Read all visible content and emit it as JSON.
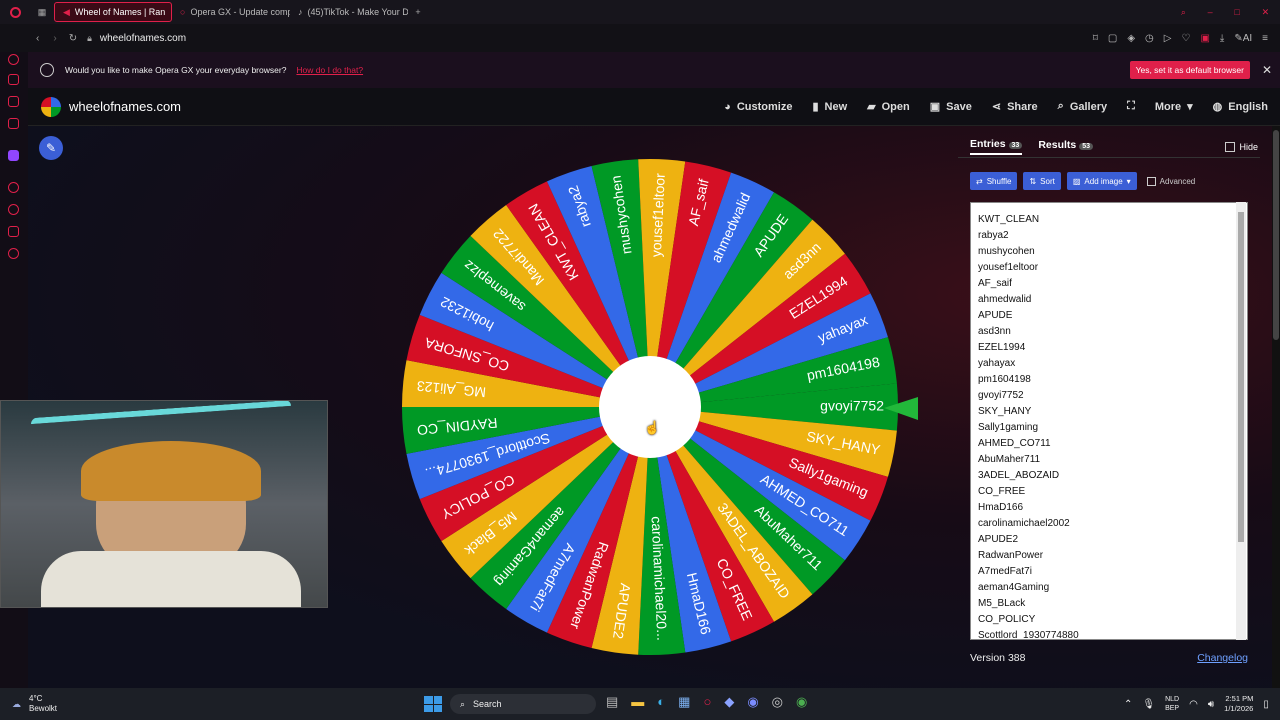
{
  "browser": {
    "tabs": [
      {
        "label": "Wheel of Names | Ran"
      },
      {
        "label": "Opera GX - Update comp"
      },
      {
        "label": "(45)TikTok - Make Your D"
      }
    ],
    "url": "wheelofnames.com",
    "ai_label": "AI"
  },
  "notification": {
    "message": "Would you like to make Opera GX your everyday browser?",
    "link": "How do I do that?",
    "action": "Yes, set it as default browser"
  },
  "site": {
    "logo": "wheelofnames.com",
    "nav": {
      "customize": "Customize",
      "new": "New",
      "open": "Open",
      "save": "Save",
      "share": "Share",
      "gallery": "Gallery",
      "more": "More",
      "language": "English"
    }
  },
  "panel": {
    "entries_tab": "Entries",
    "entries_count": "33",
    "results_tab": "Results",
    "results_count": "53",
    "hide": "Hide",
    "shuffle": "Shuffle",
    "sort": "Sort",
    "add_image": "Add image",
    "advanced": "Advanced",
    "version": "Version 388",
    "changelog": "Changelog"
  },
  "entries": [
    "KWT_CLEAN",
    "rabya2",
    "mushycohen",
    "yousef1eltoor",
    "AF_saif",
    "ahmedwalid",
    "APUDE",
    "asd3nn",
    "EZEL1994",
    "yahayax",
    "pm1604198",
    "gvoyi7752",
    "SKY_HANY",
    "Sally1gaming",
    "AHMED_CO711",
    "AbuMaher711",
    "3ADEL_ABOZAID",
    "CO_FREE",
    "HmaD166",
    "carolinamichael2002",
    "APUDE2",
    "RadwanPower",
    "A7medFat7i",
    "aeman4Gaming",
    "M5_BLack",
    "CO_POLICY",
    "Scottlord_1930774880"
  ],
  "wheel": {
    "slices": [
      "gvoyi7752",
      "SKY_HANY",
      "Sally1gaming",
      "AHMED_CO711",
      "AbuMaher711",
      "3ADEL_ABOZAID",
      "CO_FREE",
      "HmaD166",
      "carolinamichael20...",
      "APUDE2",
      "RadwanPower",
      "A7medFat7i",
      "aeman4Gaming",
      "M5_Black",
      "CO_POLICY",
      "Scottlord_1930774...",
      "RAYDIN_CO",
      "MG_Ali123",
      "CO_SNFORA",
      "hobi1232",
      "savemeplzz",
      "Mandi7722",
      "KWT_CLEAN",
      "rabya2",
      "mushycohen",
      "yousef1eltoor",
      "AF_saif",
      "ahmedwalid",
      "APUDE",
      "asd3nn",
      "EZEL1994",
      "yahayax",
      "pm1604198"
    ],
    "colors": [
      "#3369e8",
      "#009925",
      "#eeb211",
      "#d50f25"
    ]
  },
  "taskbar": {
    "weather_temp": "4°C",
    "weather_desc": "Bewolkt",
    "search": "Search",
    "lang1": "NLD",
    "lang2": "BEP",
    "time": "2:51 PM",
    "date": "1/1/2026"
  }
}
